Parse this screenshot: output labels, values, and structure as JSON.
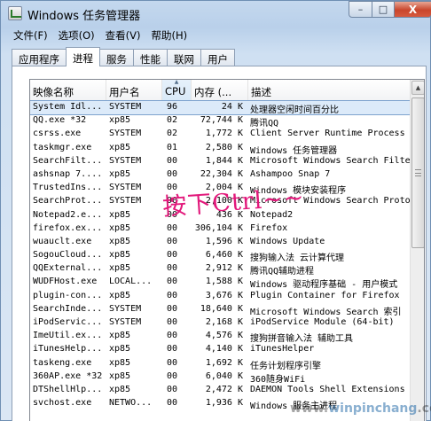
{
  "window": {
    "title": "Windows 任务管理器",
    "controls": {
      "minimize": "–",
      "maximize": "□",
      "close": "X"
    }
  },
  "menu": [
    "文件(F)",
    "选项(O)",
    "查看(V)",
    "帮助(H)"
  ],
  "tabs": [
    {
      "label": "应用程序",
      "active": false
    },
    {
      "label": "进程",
      "active": true
    },
    {
      "label": "服务",
      "active": false
    },
    {
      "label": "性能",
      "active": false
    },
    {
      "label": "联网",
      "active": false
    },
    {
      "label": "用户",
      "active": false
    }
  ],
  "columns": {
    "name": "映像名称",
    "user": "用户名",
    "cpu": "CPU",
    "mem": "内存 (...",
    "desc": "描述"
  },
  "processes": [
    {
      "name": "System Idl...",
      "user": "SYSTEM",
      "cpu": "96",
      "mem": "24 K",
      "desc": "处理器空闲时间百分比"
    },
    {
      "name": "QQ.exe *32",
      "user": "xp85",
      "cpu": "02",
      "mem": "72,744 K",
      "desc": "腾讯QQ"
    },
    {
      "name": "csrss.exe",
      "user": "SYSTEM",
      "cpu": "02",
      "mem": "1,772 K",
      "desc": "Client Server Runtime Process"
    },
    {
      "name": "taskmgr.exe",
      "user": "xp85",
      "cpu": "01",
      "mem": "2,580 K",
      "desc": "Windows 任务管理器"
    },
    {
      "name": "SearchFilt...",
      "user": "SYSTEM",
      "cpu": "00",
      "mem": "1,844 K",
      "desc": "Microsoft Windows Search Filter"
    },
    {
      "name": "ashsnap 7....",
      "user": "xp85",
      "cpu": "00",
      "mem": "22,304 K",
      "desc": "Ashampoo Snap 7"
    },
    {
      "name": "TrustedIns...",
      "user": "SYSTEM",
      "cpu": "00",
      "mem": "2,004 K",
      "desc": "Windows 模块安装程序"
    },
    {
      "name": "SearchProt...",
      "user": "SYSTEM",
      "cpu": "00",
      "mem": "2,100 K",
      "desc": "Microsoft Windows Search Proto"
    },
    {
      "name": "Notepad2.e...",
      "user": "xp85",
      "cpu": "00",
      "mem": "436 K",
      "desc": "Notepad2"
    },
    {
      "name": "firefox.ex...",
      "user": "xp85",
      "cpu": "00",
      "mem": "306,104 K",
      "desc": "Firefox"
    },
    {
      "name": "wuauclt.exe",
      "user": "xp85",
      "cpu": "00",
      "mem": "1,596 K",
      "desc": "Windows Update"
    },
    {
      "name": "SogouCloud...",
      "user": "xp85",
      "cpu": "00",
      "mem": "6,460 K",
      "desc": "搜狗输入法 云计算代理"
    },
    {
      "name": "QQExternal...",
      "user": "xp85",
      "cpu": "00",
      "mem": "2,912 K",
      "desc": "腾讯QQ辅助进程"
    },
    {
      "name": "WUDFHost.exe",
      "user": "LOCAL...",
      "cpu": "00",
      "mem": "1,588 K",
      "desc": "Windows 驱动程序基础 - 用户模式"
    },
    {
      "name": "plugin-con...",
      "user": "xp85",
      "cpu": "00",
      "mem": "3,676 K",
      "desc": "Plugin Container for Firefox"
    },
    {
      "name": "SearchInde...",
      "user": "SYSTEM",
      "cpu": "00",
      "mem": "18,640 K",
      "desc": "Microsoft Windows Search 索引"
    },
    {
      "name": "iPodServic...",
      "user": "SYSTEM",
      "cpu": "00",
      "mem": "2,168 K",
      "desc": "iPodService Module (64-bit)"
    },
    {
      "name": "ImeUtil.ex...",
      "user": "xp85",
      "cpu": "00",
      "mem": "4,576 K",
      "desc": "搜狗拼音输入法 辅助工具"
    },
    {
      "name": "iTunesHelp...",
      "user": "xp85",
      "cpu": "00",
      "mem": "4,140 K",
      "desc": "iTunesHelper"
    },
    {
      "name": "taskeng.exe",
      "user": "xp85",
      "cpu": "00",
      "mem": "1,692 K",
      "desc": "任务计划程序引擎"
    },
    {
      "name": "360AP.exe *32",
      "user": "xp85",
      "cpu": "00",
      "mem": "6,040 K",
      "desc": "360随身WiFi"
    },
    {
      "name": "DTShellHlp...",
      "user": "xp85",
      "cpu": "00",
      "mem": "2,472 K",
      "desc": "DAEMON Tools Shell Extensions"
    },
    {
      "name": "svchost.exe",
      "user": "NETWO...",
      "cpu": "00",
      "mem": "1,936 K",
      "desc": "Windows 服务主进程"
    }
  ],
  "selected_row": 0,
  "annotation": "按下Ctrl~~",
  "watermark": {
    "prefix": "www.",
    "brand": "winpinchang",
    "suffix": ".com"
  },
  "colors": {
    "selection": "#dceaf9",
    "annotation": "#e2187b",
    "close_button": "#c9462c"
  }
}
